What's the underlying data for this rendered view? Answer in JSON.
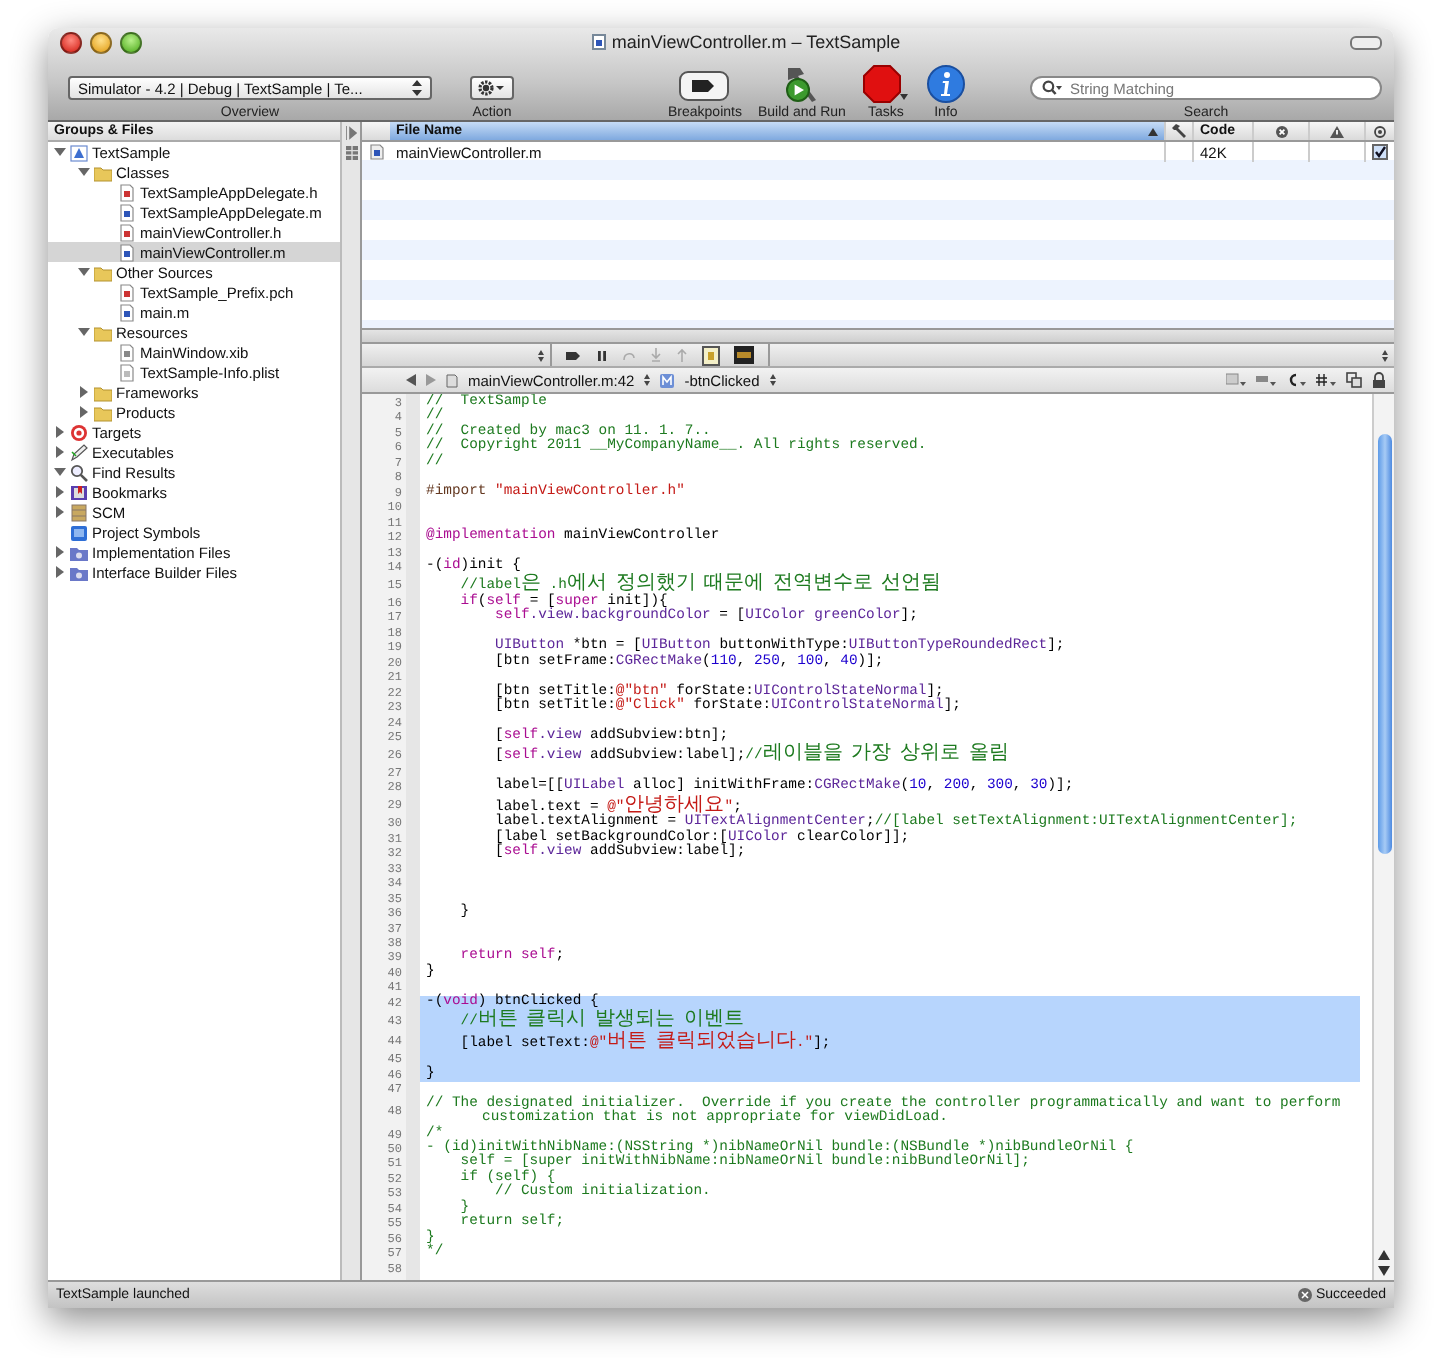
{
  "window": {
    "title": "mainViewController.m – TextSample"
  },
  "toolbar": {
    "overview": {
      "value": "Simulator - 4.2 | Debug | TextSample | Te...",
      "label": "Overview"
    },
    "action": {
      "label": "Action"
    },
    "buttons": [
      {
        "kind": "breakpoints",
        "label": "Breakpoints"
      },
      {
        "kind": "build_and_run",
        "label": "Build and Run"
      },
      {
        "kind": "tasks",
        "label": "Tasks"
      },
      {
        "kind": "info",
        "label": "Info"
      }
    ],
    "search": {
      "placeholder": "String Matching",
      "label": "Search"
    }
  },
  "sidebar": {
    "title": "Groups & Files",
    "tree": [
      {
        "label": "TextSample",
        "kind": "project",
        "expanded": true,
        "selected": false,
        "children": [
          {
            "label": "Classes",
            "kind": "folder",
            "expanded": true,
            "selected": false,
            "children": [
              {
                "label": "TextSampleAppDelegate.h",
                "kind": "header",
                "selected": false
              },
              {
                "label": "TextSampleAppDelegate.m",
                "kind": "source",
                "selected": false
              },
              {
                "label": "mainViewController.h",
                "kind": "header",
                "selected": false
              },
              {
                "label": "mainViewController.m",
                "kind": "source",
                "selected": true
              }
            ]
          },
          {
            "label": "Other Sources",
            "kind": "folder",
            "expanded": true,
            "selected": false,
            "children": [
              {
                "label": "TextSample_Prefix.pch",
                "kind": "header",
                "selected": false
              },
              {
                "label": "main.m",
                "kind": "source",
                "selected": false
              }
            ]
          },
          {
            "label": "Resources",
            "kind": "folder",
            "expanded": true,
            "selected": false,
            "children": [
              {
                "label": "MainWindow.xib",
                "kind": "xib",
                "selected": false
              },
              {
                "label": "TextSample-Info.plist",
                "kind": "plist",
                "selected": false
              }
            ]
          },
          {
            "label": "Frameworks",
            "kind": "folder",
            "expanded": false,
            "selected": false
          },
          {
            "label": "Products",
            "kind": "folder",
            "expanded": false,
            "selected": false
          }
        ]
      },
      {
        "label": "Targets",
        "kind": "target",
        "expanded": false,
        "selected": false
      },
      {
        "label": "Executables",
        "kind": "executable",
        "expanded": false,
        "selected": false
      },
      {
        "label": "Find Results",
        "kind": "find",
        "expanded": true,
        "selected": false
      },
      {
        "label": "Bookmarks",
        "kind": "bookmarks",
        "expanded": false,
        "selected": false
      },
      {
        "label": "SCM",
        "kind": "scm",
        "expanded": false,
        "selected": false
      },
      {
        "label": "Project Symbols",
        "kind": "symbols",
        "selected": false
      },
      {
        "label": "Implementation Files",
        "kind": "smart_group",
        "expanded": false,
        "selected": false
      },
      {
        "label": "Interface Builder Files",
        "kind": "smart_group",
        "expanded": false,
        "selected": false
      }
    ]
  },
  "file_list": {
    "columns": [
      {
        "kind": "name",
        "label": "File Name",
        "sorted": true
      },
      {
        "kind": "build",
        "sorted": false
      },
      {
        "kind": "text",
        "label": "Code",
        "sorted": false
      },
      {
        "kind": "errors",
        "sorted": false
      },
      {
        "kind": "warnings",
        "sorted": false
      },
      {
        "kind": "target",
        "sorted": false
      }
    ],
    "rows": [
      {
        "name": "mainViewController.m",
        "code": "42K",
        "checked": true
      }
    ]
  },
  "navigation_bar": {
    "file": "mainViewController.m:42",
    "symbol": "-btnClicked"
  },
  "editor": {
    "lines": [
      {
        "number": "3",
        "selected": false,
        "spans": [
          {
            "kind": "comment",
            "text": "//  TextSample"
          }
        ]
      },
      {
        "number": "4",
        "selected": false,
        "spans": [
          {
            "kind": "comment",
            "text": "//"
          }
        ]
      },
      {
        "number": "5",
        "selected": false,
        "spans": [
          {
            "kind": "comment",
            "text": "//  Created by mac3 on 11. 1. 7.."
          }
        ]
      },
      {
        "number": "6",
        "selected": false,
        "spans": [
          {
            "kind": "comment",
            "text": "//  Copyright 2011 __MyCompanyName__. All rights reserved."
          }
        ]
      },
      {
        "number": "7",
        "selected": false,
        "spans": [
          {
            "kind": "comment",
            "text": "//"
          }
        ]
      },
      {
        "number": "8",
        "selected": false
      },
      {
        "number": "9",
        "selected": false,
        "spans": [
          {
            "kind": "preprocessor",
            "text": "#import "
          },
          {
            "kind": "string",
            "text": "\"mainViewController.h\""
          }
        ]
      },
      {
        "number": "10",
        "selected": false
      },
      {
        "number": "11",
        "selected": false
      },
      {
        "number": "12",
        "selected": false,
        "spans": [
          {
            "kind": "keyword",
            "text": "@implementation"
          },
          {
            "kind": "plain",
            "text": " mainViewController"
          }
        ]
      },
      {
        "number": "13",
        "selected": false
      },
      {
        "number": "14",
        "selected": false,
        "spans": [
          {
            "kind": "plain",
            "text": "-("
          },
          {
            "kind": "keyword",
            "text": "id"
          },
          {
            "kind": "plain",
            "text": ")init {"
          }
        ]
      },
      {
        "number": "15",
        "selected": false,
        "spans": [
          {
            "kind": "comment",
            "text": "    //label은 .h에서 정의했기 때문에 전역변수로 선언됨"
          }
        ]
      },
      {
        "number": "16",
        "selected": false,
        "spans": [
          {
            "kind": "keyword",
            "text": "    if"
          },
          {
            "kind": "plain",
            "text": "("
          },
          {
            "kind": "keyword",
            "text": "self"
          },
          {
            "kind": "plain",
            "text": " = ["
          },
          {
            "kind": "keyword",
            "text": "super"
          },
          {
            "kind": "plain",
            "text": " init]){"
          }
        ]
      },
      {
        "number": "17",
        "selected": false,
        "spans": [
          {
            "kind": "keyword",
            "text": "        self"
          },
          {
            "kind": "type",
            "text": ".view.backgroundColor"
          },
          {
            "kind": "plain",
            "text": " = ["
          },
          {
            "kind": "type",
            "text": "UIColor greenColor"
          },
          {
            "kind": "plain",
            "text": "];"
          }
        ]
      },
      {
        "number": "18",
        "selected": false
      },
      {
        "number": "19",
        "selected": false,
        "spans": [
          {
            "kind": "type",
            "text": "        UIButton"
          },
          {
            "kind": "plain",
            "text": " *btn = ["
          },
          {
            "kind": "type",
            "text": "UIButton"
          },
          {
            "kind": "plain",
            "text": " buttonWithType:"
          },
          {
            "kind": "type",
            "text": "UIButtonTypeRoundedRect"
          },
          {
            "kind": "plain",
            "text": "];"
          }
        ]
      },
      {
        "number": "20",
        "selected": false,
        "spans": [
          {
            "kind": "plain",
            "text": "        [btn setFrame:"
          },
          {
            "kind": "type",
            "text": "CGRectMake"
          },
          {
            "kind": "plain",
            "text": "("
          },
          {
            "kind": "number",
            "text": "110"
          },
          {
            "kind": "plain",
            "text": ", "
          },
          {
            "kind": "number",
            "text": "250"
          },
          {
            "kind": "plain",
            "text": ", "
          },
          {
            "kind": "number",
            "text": "100"
          },
          {
            "kind": "plain",
            "text": ", "
          },
          {
            "kind": "number",
            "text": "40"
          },
          {
            "kind": "plain",
            "text": ")];"
          }
        ]
      },
      {
        "number": "21",
        "selected": false
      },
      {
        "number": "22",
        "selected": false,
        "spans": [
          {
            "kind": "plain",
            "text": "        [btn setTitle:"
          },
          {
            "kind": "string",
            "text": "@\"btn\""
          },
          {
            "kind": "plain",
            "text": " forState:"
          },
          {
            "kind": "type",
            "text": "UIControlStateNormal"
          },
          {
            "kind": "plain",
            "text": "];"
          }
        ]
      },
      {
        "number": "23",
        "selected": false,
        "spans": [
          {
            "kind": "plain",
            "text": "        [btn setTitle:"
          },
          {
            "kind": "string",
            "text": "@\"Click\""
          },
          {
            "kind": "plain",
            "text": " forState:"
          },
          {
            "kind": "type",
            "text": "UIControlStateNormal"
          },
          {
            "kind": "plain",
            "text": "];"
          }
        ]
      },
      {
        "number": "24",
        "selected": false
      },
      {
        "number": "25",
        "selected": false,
        "spans": [
          {
            "kind": "plain",
            "text": "        ["
          },
          {
            "kind": "keyword",
            "text": "self"
          },
          {
            "kind": "type",
            "text": ".view"
          },
          {
            "kind": "plain",
            "text": " addSubview:btn];"
          }
        ]
      },
      {
        "number": "26",
        "selected": false,
        "spans": [
          {
            "kind": "plain",
            "text": "        ["
          },
          {
            "kind": "keyword",
            "text": "self"
          },
          {
            "kind": "type",
            "text": ".view"
          },
          {
            "kind": "plain",
            "text": " addSubview:label];"
          },
          {
            "kind": "comment",
            "text": "//레이블을 가장 상위로 올림"
          }
        ]
      },
      {
        "number": "27",
        "selected": false
      },
      {
        "number": "28",
        "selected": false,
        "spans": [
          {
            "kind": "plain",
            "text": "        label=[["
          },
          {
            "kind": "type",
            "text": "UILabel"
          },
          {
            "kind": "plain",
            "text": " alloc] initWithFrame:"
          },
          {
            "kind": "type",
            "text": "CGRectMake"
          },
          {
            "kind": "plain",
            "text": "("
          },
          {
            "kind": "number",
            "text": "10"
          },
          {
            "kind": "plain",
            "text": ", "
          },
          {
            "kind": "number",
            "text": "200"
          },
          {
            "kind": "plain",
            "text": ", "
          },
          {
            "kind": "number",
            "text": "300"
          },
          {
            "kind": "plain",
            "text": ", "
          },
          {
            "kind": "number",
            "text": "30"
          },
          {
            "kind": "plain",
            "text": ")];"
          }
        ]
      },
      {
        "number": "29",
        "selected": false,
        "spans": [
          {
            "kind": "plain",
            "text": "        label.text = "
          },
          {
            "kind": "string",
            "text": "@\"안녕하세요\""
          },
          {
            "kind": "plain",
            "text": ";"
          }
        ]
      },
      {
        "number": "30",
        "selected": false,
        "spans": [
          {
            "kind": "plain",
            "text": "        label.textAlignment = "
          },
          {
            "kind": "type",
            "text": "UITextAlignmentCenter"
          },
          {
            "kind": "plain",
            "text": ";"
          },
          {
            "kind": "comment",
            "text": "//[label setTextAlignment:UITextAlignmentCenter];"
          }
        ]
      },
      {
        "number": "31",
        "selected": false,
        "spans": [
          {
            "kind": "plain",
            "text": "        [label setBackgroundColor:["
          },
          {
            "kind": "type",
            "text": "UIColor"
          },
          {
            "kind": "plain",
            "text": " clearColor]];"
          }
        ]
      },
      {
        "number": "32",
        "selected": false,
        "spans": [
          {
            "kind": "plain",
            "text": "        ["
          },
          {
            "kind": "keyword",
            "text": "self"
          },
          {
            "kind": "type",
            "text": ".view"
          },
          {
            "kind": "plain",
            "text": " addSubview:label];"
          }
        ]
      },
      {
        "number": "33",
        "selected": false
      },
      {
        "number": "34",
        "selected": false
      },
      {
        "number": "35",
        "selected": false
      },
      {
        "number": "36",
        "selected": false,
        "spans": [
          {
            "kind": "plain",
            "text": "    }"
          }
        ]
      },
      {
        "number": "37",
        "selected": false
      },
      {
        "number": "38",
        "selected": false
      },
      {
        "number": "39",
        "selected": false,
        "spans": [
          {
            "kind": "keyword",
            "text": "    return self"
          },
          {
            "kind": "plain",
            "text": ";"
          }
        ]
      },
      {
        "number": "40",
        "selected": false,
        "spans": [
          {
            "kind": "plain",
            "text": "}"
          }
        ]
      },
      {
        "number": "41",
        "selected": false
      },
      {
        "number": "42",
        "selected": true,
        "spans": [
          {
            "kind": "plain",
            "text": "-("
          },
          {
            "kind": "keyword",
            "text": "void"
          },
          {
            "kind": "plain",
            "text": ") btnClicked {"
          }
        ]
      },
      {
        "number": "43",
        "selected": true,
        "spans": [
          {
            "kind": "comment",
            "text": "    //버튼 클릭시 발생되는 이벤트"
          }
        ]
      },
      {
        "number": "44",
        "selected": true,
        "spans": [
          {
            "kind": "plain",
            "text": "    [label setText:"
          },
          {
            "kind": "string",
            "text": "@\"버튼 클릭되었습니다.\""
          },
          {
            "kind": "plain",
            "text": "];"
          }
        ]
      },
      {
        "number": "45",
        "selected": true
      },
      {
        "number": "46",
        "selected": true,
        "spans": [
          {
            "kind": "plain",
            "text": "}"
          }
        ]
      },
      {
        "number": "47",
        "selected": false
      },
      {
        "number": "48",
        "selected": false,
        "spans": [
          {
            "kind": "comment",
            "text": "// The designated initializer.  Override if you create the controller programmatically and want to perform customization that is not appropriate for viewDidLoad."
          }
        ]
      },
      {
        "number": "49",
        "selected": false,
        "spans": [
          {
            "kind": "comment",
            "text": "/*"
          }
        ]
      },
      {
        "number": "50",
        "selected": false,
        "spans": [
          {
            "kind": "comment",
            "text": "- (id)initWithNibName:(NSString *)nibNameOrNil bundle:(NSBundle *)nibBundleOrNil {"
          }
        ]
      },
      {
        "number": "51",
        "selected": false,
        "spans": [
          {
            "kind": "comment",
            "text": "    self = [super initWithNibName:nibNameOrNil bundle:nibBundleOrNil];"
          }
        ]
      },
      {
        "number": "52",
        "selected": false,
        "spans": [
          {
            "kind": "comment",
            "text": "    if (self) {"
          }
        ]
      },
      {
        "number": "53",
        "selected": false,
        "spans": [
          {
            "kind": "comment",
            "text": "        // Custom initialization."
          }
        ]
      },
      {
        "number": "54",
        "selected": false,
        "spans": [
          {
            "kind": "comment",
            "text": "    }"
          }
        ]
      },
      {
        "number": "55",
        "selected": false,
        "spans": [
          {
            "kind": "comment",
            "text": "    return self;"
          }
        ]
      },
      {
        "number": "56",
        "selected": false,
        "spans": [
          {
            "kind": "comment",
            "text": "}"
          }
        ]
      },
      {
        "number": "57",
        "selected": false,
        "spans": [
          {
            "kind": "comment",
            "text": "*/"
          }
        ]
      },
      {
        "number": "58",
        "selected": false
      }
    ]
  },
  "status_bar": {
    "message": "TextSample launched",
    "result": "Succeeded"
  }
}
